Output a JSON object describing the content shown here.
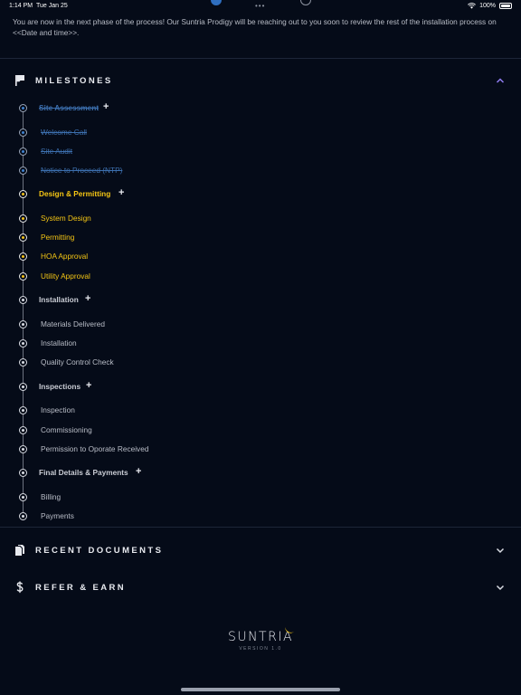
{
  "status_bar": {
    "time": "1:14 PM",
    "date": "Tue Jan 25",
    "dots": "•••",
    "battery": "100%"
  },
  "message": "You are now in the next phase of the process! Our Suntria Prodigy will be reaching out to you soon to review the rest of the installation process on <<Date and time>>.",
  "milestones": {
    "title": "MILESTONES",
    "groups": [
      {
        "label": "Site Assessment",
        "plus": "+",
        "state": "done",
        "items": [
          {
            "label": "Welcome Call",
            "state": "done"
          },
          {
            "label": "Site Audit",
            "state": "done"
          },
          {
            "label": "Notice to Proceed (NTP)",
            "state": "done"
          }
        ]
      },
      {
        "label": "Design & Permitting",
        "plus": "+",
        "state": "active",
        "items": [
          {
            "label": "System Design",
            "state": "active"
          },
          {
            "label": "Permitting",
            "state": "active"
          },
          {
            "label": "HOA Approval",
            "state": "active"
          },
          {
            "label": "Utility Approval",
            "state": "active"
          }
        ]
      },
      {
        "label": "Installation",
        "plus": "+",
        "state": "pending",
        "items": [
          {
            "label": "Materials Delivered",
            "state": "pending"
          },
          {
            "label": "Installation",
            "state": "pending"
          },
          {
            "label": "Quality Control Check",
            "state": "pending"
          }
        ]
      },
      {
        "label": "Inspections",
        "plus": "+",
        "state": "pending",
        "items": [
          {
            "label": "Inspection",
            "state": "pending"
          },
          {
            "label": "Commissioning",
            "state": "pending"
          },
          {
            "label": "Permission to Oporate Received",
            "state": "pending"
          }
        ]
      },
      {
        "label": "Final Details & Payments",
        "plus": "+",
        "state": "pending",
        "items": [
          {
            "label": "Billing",
            "state": "pending"
          },
          {
            "label": "Payments",
            "state": "pending"
          }
        ]
      }
    ]
  },
  "recent_documents": {
    "title": "RECENT DOCUMENTS"
  },
  "refer_earn": {
    "title": "REFER & EARN"
  },
  "footer": {
    "logo": "SUNTRIA",
    "version": "VERSION 1.0"
  },
  "colors": {
    "background": "#050b18",
    "done": "#3c6fae",
    "active": "#f4c514",
    "accent": "#8f7cf0"
  },
  "icons": {
    "milestones": "flag-icon",
    "documents": "documents-icon",
    "refer": "dollar-icon",
    "collapse": "chevron-up-icon",
    "expand": "chevron-down-icon"
  }
}
